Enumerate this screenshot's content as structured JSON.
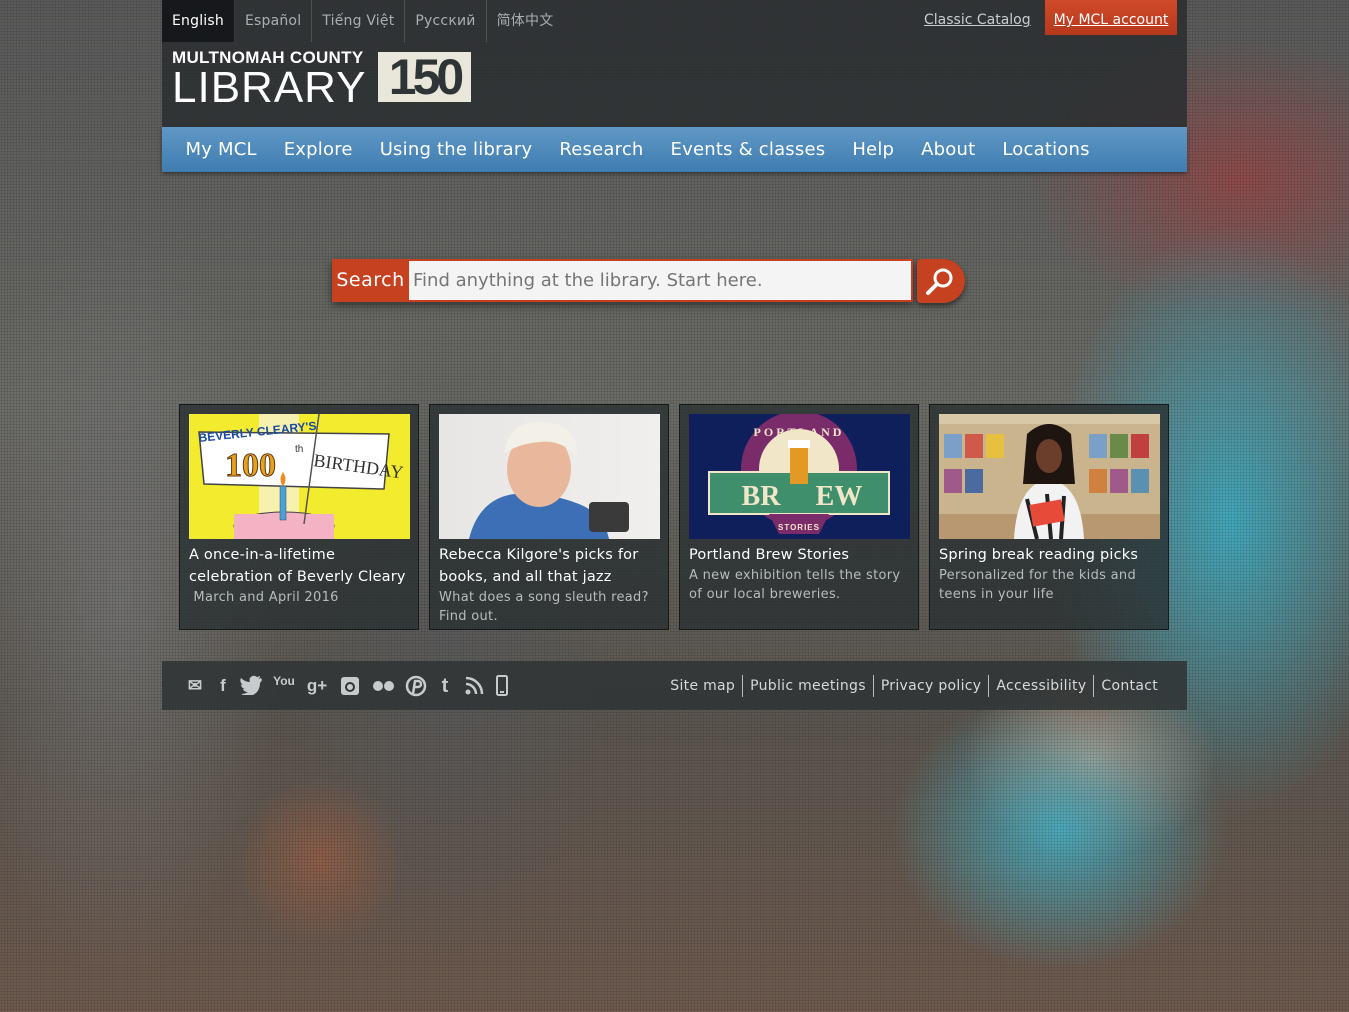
{
  "languages": [
    "English",
    "Español",
    "Tiếng Việt",
    "Русский",
    "简体中文"
  ],
  "header": {
    "classic_catalog": "Classic Catalog",
    "account": "My MCL account",
    "logo_top": "MULTNOMAH COUNTY",
    "logo_main": "LIBRARY",
    "logo_badge": "150"
  },
  "nav": [
    "My MCL",
    "Explore",
    "Using the library",
    "Research",
    "Events & classes",
    "Help",
    "About",
    "Locations"
  ],
  "search": {
    "label": "Search",
    "placeholder": "Find anything at the library. Start here.",
    "button_icon": "magnifier-icon"
  },
  "cards": [
    {
      "title": "A once-in-a-lifetime celebration of Beverly Cleary",
      "subtitle": " March and April 2016",
      "image_text": [
        "BEVERLY CLEARY'S",
        "100",
        "th",
        "BIRTHDAY"
      ]
    },
    {
      "title": "Rebecca Kilgore's picks for books, and all that jazz",
      "subtitle": "What does a song sleuth read? Find out."
    },
    {
      "title": "Portland Brew Stories",
      "subtitle": "A new exhibition tells the story of our local breweries.",
      "image_text": [
        "PORTLAND",
        "BR",
        "EW",
        "STORIES"
      ]
    },
    {
      "title": "Spring break reading picks",
      "subtitle": "Personalized for the kids and teens in your life"
    }
  ],
  "social_icons": [
    "email-icon",
    "facebook-icon",
    "twitter-icon",
    "youtube-icon",
    "googleplus-icon",
    "instagram-icon",
    "flickr-icon",
    "pinterest-icon",
    "tumblr-icon",
    "rss-icon",
    "mobile-icon"
  ],
  "social_glyphs": [
    "✉",
    "f",
    "🐦",
    "You",
    "g+",
    "◙",
    "●●",
    "℗",
    "t",
    "◠",
    "▯"
  ],
  "footer_links": [
    "Site map",
    "Public meetings",
    "Privacy policy",
    "Accessibility",
    "Contact"
  ]
}
